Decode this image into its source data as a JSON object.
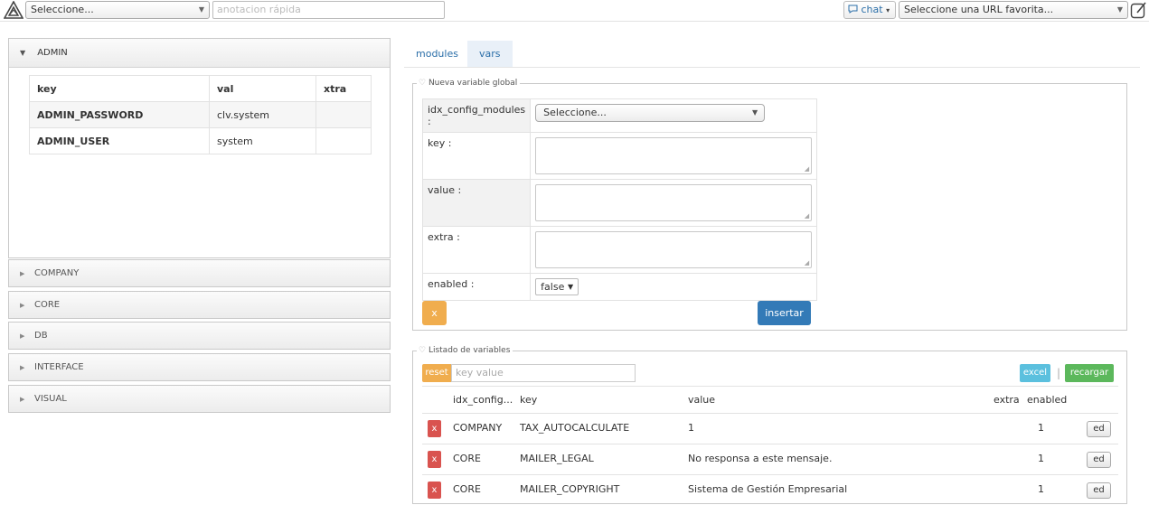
{
  "topbar": {
    "module_select": "Seleccione...",
    "quick_note_placeholder": "anotacion rápida",
    "chat_label": "chat",
    "url_select": "Seleccione una URL favorita..."
  },
  "accordion": {
    "open_section": "ADMIN",
    "table": {
      "headers": [
        "key",
        "val",
        "xtra"
      ],
      "rows": [
        {
          "key": "ADMIN_PASSWORD",
          "val": "clv.system",
          "xtra": ""
        },
        {
          "key": "ADMIN_USER",
          "val": "system",
          "xtra": ""
        }
      ]
    },
    "closed_sections": [
      "COMPANY",
      "CORE",
      "DB",
      "INTERFACE",
      "VISUAL"
    ]
  },
  "tabs": [
    "modules",
    "vars"
  ],
  "new_var": {
    "legend": "Nueva variable global",
    "fields": {
      "module_label": "idx_config_modules :",
      "module_value": "Seleccione...",
      "key_label": "key :",
      "value_label": "value :",
      "extra_label": "extra :",
      "enabled_label": "enabled :",
      "enabled_value": "false"
    },
    "cancel_label": "x",
    "insert_label": "insertar"
  },
  "list": {
    "legend": "Listado de variables",
    "reset_label": "reset",
    "filter_placeholder": "key value",
    "excel_label": "excel",
    "separator": "|",
    "reload_label": "recargar",
    "headers": {
      "module": "idx_config...",
      "key": "key",
      "value": "value",
      "extra": "extra",
      "enabled": "enabled"
    },
    "rows": [
      {
        "del": "x",
        "module": "COMPANY",
        "key": "TAX_AUTOCALCULATE",
        "value": "1",
        "extra": "",
        "enabled": "1",
        "edit": "ed"
      },
      {
        "del": "x",
        "module": "CORE",
        "key": "MAILER_LEGAL",
        "value": "No responsa a este mensaje.",
        "extra": "",
        "enabled": "1",
        "edit": "ed"
      },
      {
        "del": "x",
        "module": "CORE",
        "key": "MAILER_COPYRIGHT",
        "value": "Sistema de Gestión Empresarial",
        "extra": "",
        "enabled": "1",
        "edit": "ed"
      }
    ]
  }
}
